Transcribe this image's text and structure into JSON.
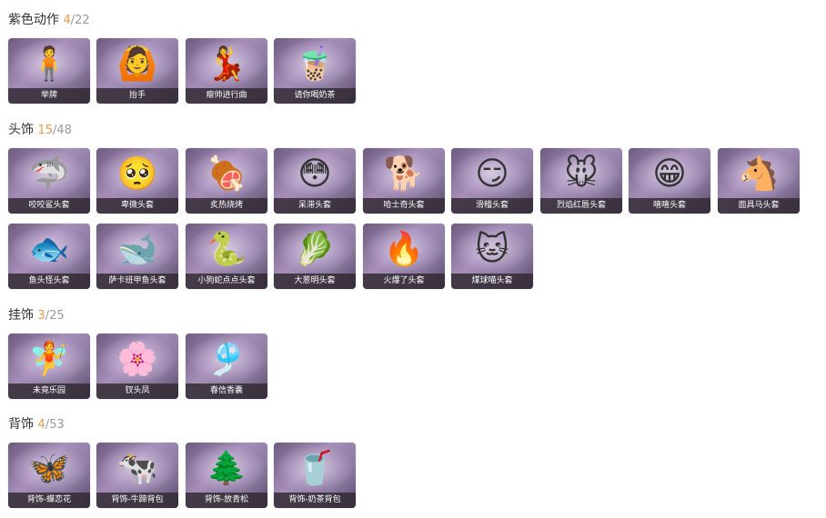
{
  "sections": [
    {
      "title": "紫色动作",
      "owned": "4",
      "total": "/22",
      "items": [
        {
          "label": "举牌",
          "icon": "🧍"
        },
        {
          "label": "抬手",
          "icon": "🙆"
        },
        {
          "label": "瘪帅进行曲",
          "icon": "💃"
        },
        {
          "label": "请你喝奶茶",
          "icon": "🧋"
        }
      ]
    },
    {
      "title": "头饰",
      "owned": "15",
      "total": "/48",
      "items": [
        {
          "label": "咬咬鲨头套",
          "icon": "🦈"
        },
        {
          "label": "卑微头套",
          "icon": "🥺"
        },
        {
          "label": "炙热烧烤",
          "icon": "🍖"
        },
        {
          "label": "呆滞头套",
          "icon": "😳"
        },
        {
          "label": "哈士奇头套",
          "icon": "🐕"
        },
        {
          "label": "滑稽头套",
          "icon": "😏"
        },
        {
          "label": "烈焰红唇头套",
          "icon": "🐭"
        },
        {
          "label": "嘻嘻头套",
          "icon": "😁"
        },
        {
          "label": "面具马头套",
          "icon": "🐴"
        },
        {
          "label": "鱼头怪头套",
          "icon": "🐟"
        },
        {
          "label": "萨卡班甲鱼头套",
          "icon": "🐋"
        },
        {
          "label": "小狗蛇点点头套",
          "icon": "🐍"
        },
        {
          "label": "大葱明头套",
          "icon": "🥬"
        },
        {
          "label": "火爆了头套",
          "icon": "🔥"
        },
        {
          "label": "煤球喵头套",
          "icon": "🐱"
        }
      ]
    },
    {
      "title": "挂饰",
      "owned": "3",
      "total": "/25",
      "items": [
        {
          "label": "未竟乐园",
          "icon": "🧚"
        },
        {
          "label": "钗头凤",
          "icon": "🌸"
        },
        {
          "label": "春信香囊",
          "icon": "🎐"
        }
      ]
    },
    {
      "title": "背饰",
      "owned": "4",
      "total": "/53",
      "items": [
        {
          "label": "背饰-蝶恋花",
          "icon": "🦋"
        },
        {
          "label": "背饰-牛蹄背包",
          "icon": "🐄"
        },
        {
          "label": "背饰-放青松",
          "icon": "🌲"
        },
        {
          "label": "背饰-奶茶背包",
          "icon": "🥤"
        }
      ]
    }
  ]
}
